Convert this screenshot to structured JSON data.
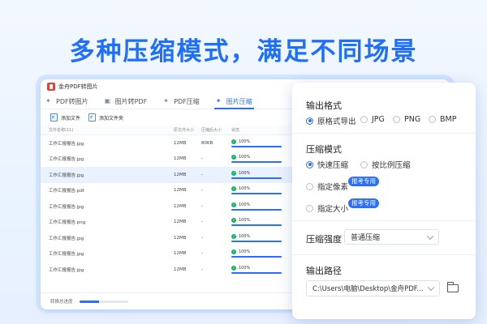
{
  "headline": "多种压缩模式，满足不同场景",
  "app": {
    "title": "金舟PDF转图片",
    "tabs": [
      {
        "label": "PDF转图片",
        "icon": "pdf-icon",
        "active": false
      },
      {
        "label": "图片转PDF",
        "icon": "image-icon",
        "active": false
      },
      {
        "label": "PDF压缩",
        "icon": "pdf-compress-icon",
        "active": false
      },
      {
        "label": "图片压缩",
        "icon": "image-compress-icon",
        "active": true
      }
    ],
    "actions": {
      "add_file": "添加文件",
      "add_folder": "添加文件夹"
    },
    "table": {
      "headers": {
        "name": "文件名称(11)",
        "orig_size": "原文件大小",
        "out_size": "压缩后大小",
        "status": "状态"
      },
      "rows": [
        {
          "name": "工作汇报报告.jpg",
          "orig": "12MB",
          "out": "80KB",
          "status": "100%",
          "highlight": false
        },
        {
          "name": "工作汇报报告.jpg",
          "orig": "12MB",
          "out": "-",
          "status": "100%",
          "highlight": false
        },
        {
          "name": "工作汇报报告.jpg",
          "orig": "12MB",
          "out": "-",
          "status": "100%",
          "highlight": true
        },
        {
          "name": "工作汇报报告.pdf",
          "orig": "12MB",
          "out": "-",
          "status": "100%",
          "highlight": false
        },
        {
          "name": "工作汇报报告.jpg",
          "orig": "12MB",
          "out": "-",
          "status": "100%",
          "highlight": false
        },
        {
          "name": "工作汇报报告.png",
          "orig": "12MB",
          "out": "-",
          "status": "100%",
          "highlight": false
        },
        {
          "name": "工作汇报报告.jpg",
          "orig": "12MB",
          "out": "-",
          "status": "100%",
          "highlight": false
        },
        {
          "name": "工作汇报报告.jpg",
          "orig": "12MB",
          "out": "-",
          "status": "100%",
          "highlight": false
        },
        {
          "name": "工作汇报报告.jpg",
          "orig": "12MB",
          "out": "-",
          "status": "100%",
          "highlight": false
        }
      ]
    },
    "footer": {
      "progress_label": "转换总进度",
      "progress": 0.4
    }
  },
  "panel": {
    "output_format": {
      "title": "输出格式",
      "options": [
        {
          "label": "原格式导出",
          "checked": true
        },
        {
          "label": "JPG",
          "checked": false
        },
        {
          "label": "PNG",
          "checked": false
        },
        {
          "label": "BMP",
          "checked": false
        }
      ]
    },
    "compress_mode": {
      "title": "压缩模式",
      "options": [
        {
          "label": "快速压缩",
          "checked": true
        },
        {
          "label": "按比例压缩",
          "checked": false
        },
        {
          "label": "指定像素",
          "checked": false
        },
        {
          "label": "指定大小",
          "checked": false
        }
      ],
      "badge": "报考专用"
    },
    "strength": {
      "label": "压缩强度",
      "value": "普通压缩"
    },
    "output_path": {
      "title": "输出路径",
      "value": "C:\\Users\\电脑\\Desktop\\金舟PDF..."
    }
  },
  "colors": {
    "accent": "#2a6fff",
    "success": "#17b26a",
    "headline": "#1f6fff"
  }
}
